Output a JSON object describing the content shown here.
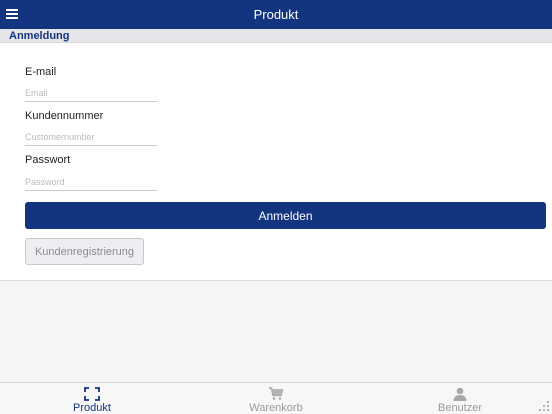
{
  "header": {
    "title": "Produkt"
  },
  "section": {
    "title": "Anmeldung"
  },
  "form": {
    "email": {
      "label": "E-mail",
      "placeholder": "Email",
      "value": ""
    },
    "customer_number": {
      "label": "Kundennummer",
      "placeholder": "Customernumber",
      "value": ""
    },
    "password": {
      "label": "Passwort",
      "placeholder": "Password",
      "value": ""
    },
    "login_label": "Anmelden",
    "register_label": "Kundenregistrierung"
  },
  "tabs": [
    {
      "label": "Produkt",
      "icon": "scan-icon",
      "active": true
    },
    {
      "label": "Warenkorb",
      "icon": "cart-icon",
      "active": false
    },
    {
      "label": "Benutzer",
      "icon": "user-icon",
      "active": false
    }
  ],
  "colors": {
    "primary": "#133580",
    "inactive": "#9a9a9a",
    "background": "#f5f5f5"
  }
}
